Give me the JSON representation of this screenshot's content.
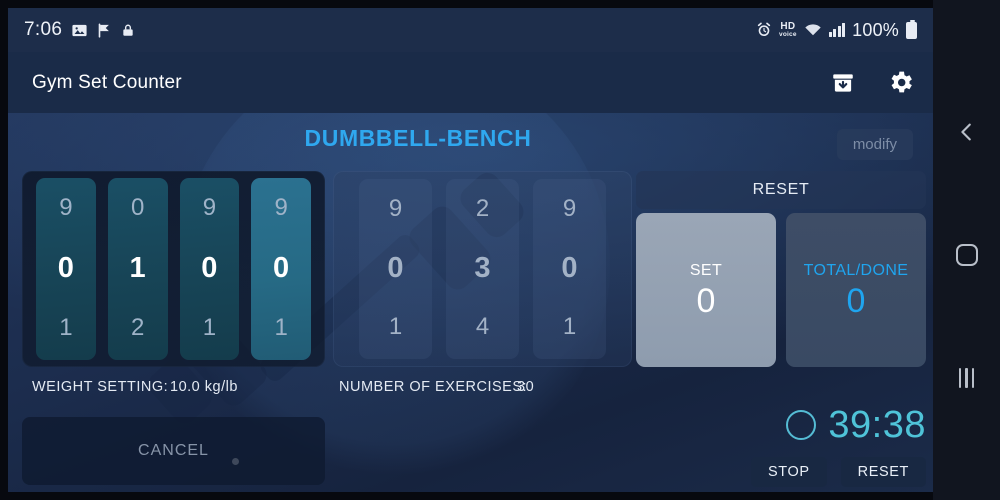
{
  "status_bar": {
    "time": "7:06",
    "battery_percent": "100%",
    "hd_badge_top": "HD",
    "hd_badge_bottom": "voice",
    "left_icons": [
      "photo-icon",
      "flag-check-icon",
      "lock-icon"
    ],
    "right_icons": [
      "alarm-clock-icon",
      "hd-voice-icon",
      "wifi-icon",
      "signal-bars-icon",
      "battery-icon"
    ]
  },
  "app_bar": {
    "title": "Gym Set Counter",
    "actions": [
      "archive-download-icon",
      "gear-icon"
    ]
  },
  "content": {
    "exercise_title": "DUMBBELL-BENCH",
    "modify_label": "modify",
    "weight_picker": {
      "columns": [
        {
          "above": "9",
          "selected": "0",
          "below": "1",
          "highlight": false
        },
        {
          "above": "0",
          "selected": "1",
          "below": "2",
          "highlight": false
        },
        {
          "above": "9",
          "selected": "0",
          "below": "1",
          "highlight": false
        },
        {
          "above": "9",
          "selected": "0",
          "below": "1",
          "highlight": true
        }
      ],
      "decimal_separator": "."
    },
    "exercise_picker": {
      "columns": [
        {
          "above": "9",
          "selected": "0",
          "below": "1"
        },
        {
          "above": "2",
          "selected": "3",
          "below": "4"
        },
        {
          "above": "9",
          "selected": "0",
          "below": "1"
        }
      ]
    },
    "weight_setting_label": "WEIGHT SETTING:",
    "weight_setting_value": "10.0 kg/lb",
    "exercises_label": "NUMBER OF EXERCISES:",
    "exercises_value": "30",
    "cancel_label": "CANCEL",
    "reset_bar_label": "RESET",
    "set_box": {
      "label": "SET",
      "value": "0"
    },
    "total_box": {
      "label": "TOTAL/DONE",
      "value": "0"
    },
    "timer": {
      "value": "39:38",
      "stop_label": "STOP",
      "reset_label": "RESET"
    }
  },
  "nav_bar": {
    "back": "back-chevron-icon",
    "home": "home-square-icon",
    "recents": "recents-bars-icon"
  },
  "colors": {
    "accent_blue": "#2fa8ef",
    "timer_teal": "#4fc3d8",
    "panel_navy": "#1b2c4d",
    "wheel_teal": "#174456",
    "wheel_teal_bright": "#266a85"
  }
}
